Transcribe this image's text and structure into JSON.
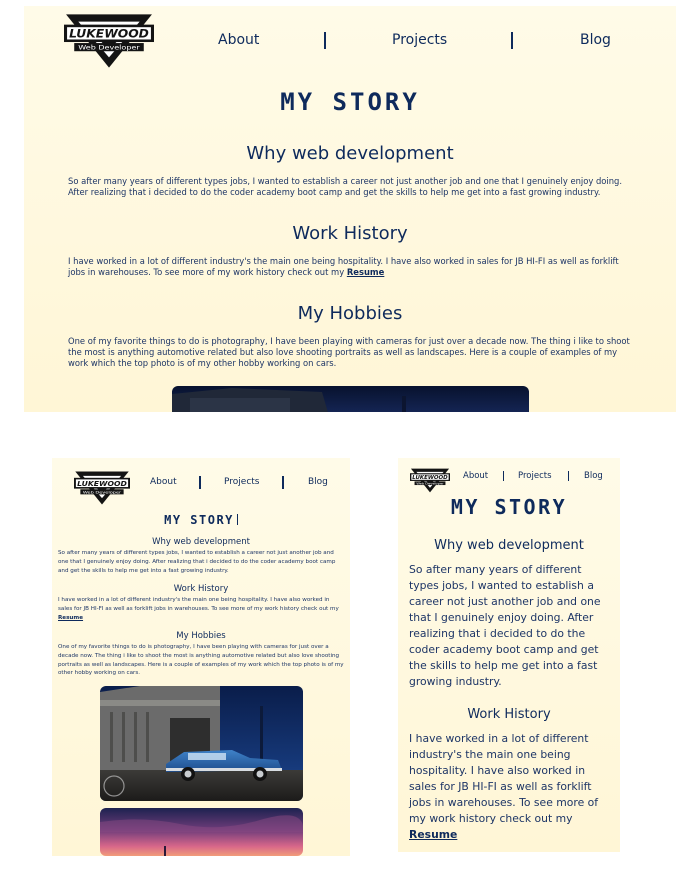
{
  "brand": {
    "logo_text": "LUKEWOOD",
    "logo_subtext": "Web Developer"
  },
  "nav": {
    "about": "About",
    "projects": "Projects",
    "blog": "Blog"
  },
  "page": {
    "title": "MY STORY"
  },
  "sections": [
    {
      "heading": "Why web development",
      "text": "So after many years of different types jobs, I wanted to establish a career not just another job and one that I genuinely enjoy doing. After realizing that i decided to do the coder academy boot camp and get the skills to help me get into a fast growing industry."
    },
    {
      "heading": "Work History",
      "text": "I have worked in a lot of different industry's the main one being hospitality. I have also worked in sales for JB HI-FI as well as forklift jobs in warehouses. To see more of my work history check out my",
      "link": "Resume"
    },
    {
      "heading": "My Hobbies",
      "text": "One of my favorite things to do is photography, I have been playing with cameras for just over a decade now. The thing i like to shoot the most is anything automotive related but also love shooting portraits as well as landscapes. Here is a couple of examples of my work which the top photo is of my other hobby working on cars."
    }
  ],
  "colors": {
    "primary": "#0e2a5c",
    "background": "#fff8e1"
  },
  "images": {
    "car_photo": "classic-blue-car-photo",
    "sunset_photo": "sunset-landscape-photo",
    "night_photo": "night-street-photo"
  }
}
